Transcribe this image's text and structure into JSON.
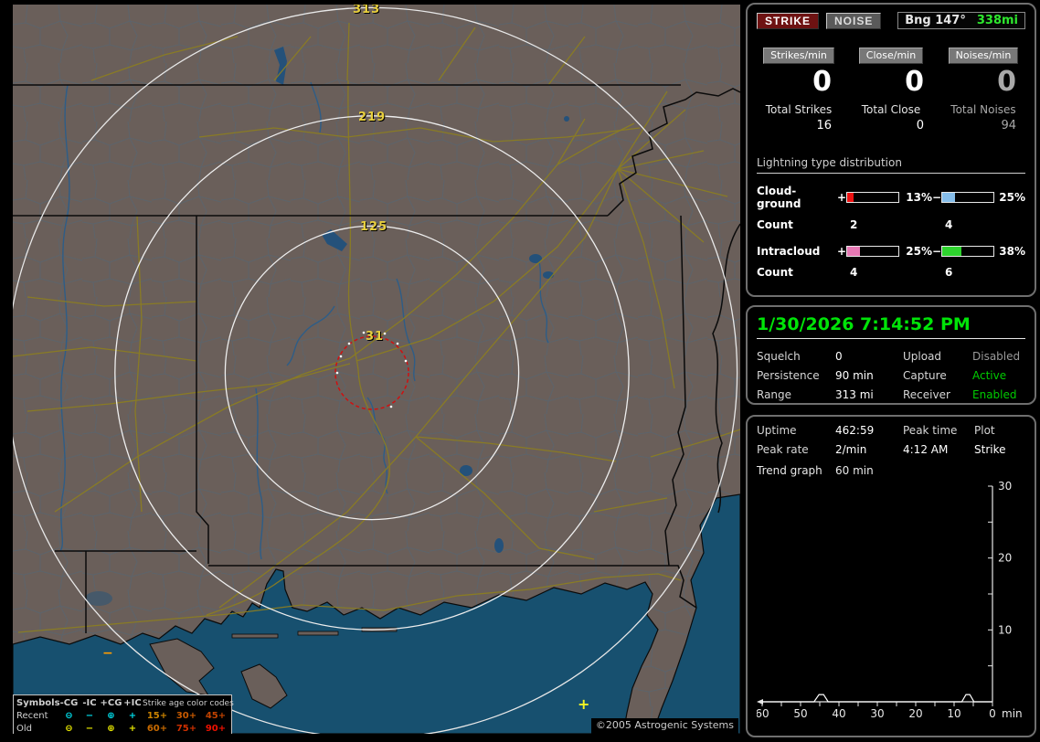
{
  "toolbar": {
    "strike_label": "STRIKE",
    "noise_label": "NOISE",
    "bearing_label": "Bng 147°",
    "bearing_distance": "338mi",
    "bearing_distance_color": "#2ee82e"
  },
  "counters": {
    "columns": [
      {
        "chip": "Strikes/min",
        "rate": "0",
        "total_label": "Total Strikes",
        "total": "16"
      },
      {
        "chip": "Close/min",
        "rate": "0",
        "total_label": "Total Close",
        "total": "0"
      },
      {
        "chip": "Noises/min",
        "rate": "0",
        "total_label": "Total Noises",
        "total": "94"
      }
    ]
  },
  "distribution": {
    "title": "Lightning type distribution",
    "rows": [
      {
        "label": "Cloud-ground",
        "plus_sign": "+",
        "minus_sign": "−",
        "plus_pct": "13%",
        "minus_pct": "25%",
        "plus_style": "width:13%;background:#ee1111",
        "minus_style": "width:25%;background:#85bdea",
        "plus_color": "#ee1111",
        "minus_color": "#85bdea",
        "count_label": "Count",
        "plus_count": "2",
        "minus_count": "4"
      },
      {
        "label": "Intracloud",
        "plus_sign": "+",
        "minus_sign": "−",
        "plus_pct": "25%",
        "minus_pct": "38%",
        "plus_style": "width:25%;background:#e678b4",
        "minus_style": "width:38%;background:#2ed32e",
        "plus_color": "#e678b4",
        "minus_color": "#2ed32e",
        "count_label": "Count",
        "plus_count": "4",
        "minus_count": "6"
      }
    ]
  },
  "status": {
    "datetime": "1/30/2026 7:14:52 PM",
    "datetime_color": "#00e408",
    "rows": [
      {
        "l1": "Squelch",
        "v1": "0",
        "l2": "Upload",
        "v2": "Disabled",
        "v2_style": "color:#9a9a9a"
      },
      {
        "l1": "Persistence",
        "v1": "90 min",
        "l2": "Capture",
        "v2": "Active",
        "v2_style": "color:#00cc00"
      },
      {
        "l1": "Range",
        "v1": "313 mi",
        "l2": "Receiver",
        "v2": "Enabled",
        "v2_style": "color:#00cc00"
      }
    ]
  },
  "trend": {
    "uptime_label": "Uptime",
    "uptime": "462:59",
    "peak_time_label": "Peak time",
    "plot_label": "Plot",
    "peak_rate_label": "Peak rate",
    "peak_rate": "2/min",
    "peak_time": "4:12 AM",
    "plot_mode": "Strike",
    "graph_label": "Trend graph",
    "graph_window": "60 min"
  },
  "chart_data": {
    "type": "line",
    "xlabel": "min",
    "x_ticks": [
      60,
      50,
      40,
      30,
      20,
      10,
      0
    ],
    "y_ticks": [
      10,
      20,
      30
    ],
    "xlim": [
      60,
      0
    ],
    "ylim": [
      0,
      30
    ],
    "grid": false,
    "axis_color": "#e8e8e8",
    "series": [
      {
        "name": "Strike",
        "points": [
          [
            60,
            0
          ],
          [
            46.5,
            0
          ],
          [
            45.2,
            1
          ],
          [
            44,
            1
          ],
          [
            42.8,
            0
          ],
          [
            8,
            0
          ],
          [
            6.9,
            1
          ],
          [
            5.9,
            1
          ],
          [
            4.8,
            0
          ],
          [
            0,
            0
          ]
        ]
      }
    ]
  },
  "map": {
    "rings": [
      {
        "label": "313"
      },
      {
        "label": "219"
      },
      {
        "label": "125"
      },
      {
        "label": "31"
      }
    ],
    "ring_label_color": "#e8cf3d",
    "range_ring_color": "#eeeeee",
    "close_ring_color": "#d01010",
    "markers": [
      {
        "glyph": "+",
        "color": "#f5f523"
      },
      {
        "glyph": "−",
        "color": "#ff9d00"
      }
    ],
    "legend": {
      "col_symbols": "Symbols",
      "col_cg_neg": "-CG",
      "col_ic_neg": "-IC",
      "col_cg_pos": "+CG",
      "col_ic_pos": "+IC",
      "age_title": "Strike age color codes",
      "recent_label": "Recent",
      "old_label": "Old",
      "recent_color": "#00dce8",
      "old_color": "#e8e800",
      "recent_syms": [
        "⊖",
        "−",
        "⊕",
        "+"
      ],
      "old_syms": [
        "⊖",
        "−",
        "⊕",
        "+"
      ],
      "recent_ages": [
        {
          "t": "15+",
          "style": "color:#cc8400"
        },
        {
          "t": "30+",
          "style": "color:#c85a00"
        },
        {
          "t": "45+",
          "style": "color:#c24300"
        }
      ],
      "old_ages": [
        {
          "t": "60+",
          "style": "color:#c86a00"
        },
        {
          "t": "75+",
          "style": "color:#d03000"
        },
        {
          "t": "90+",
          "style": "color:#ee1100"
        }
      ]
    },
    "copyright": "©2005 Astrogenic Systems"
  }
}
